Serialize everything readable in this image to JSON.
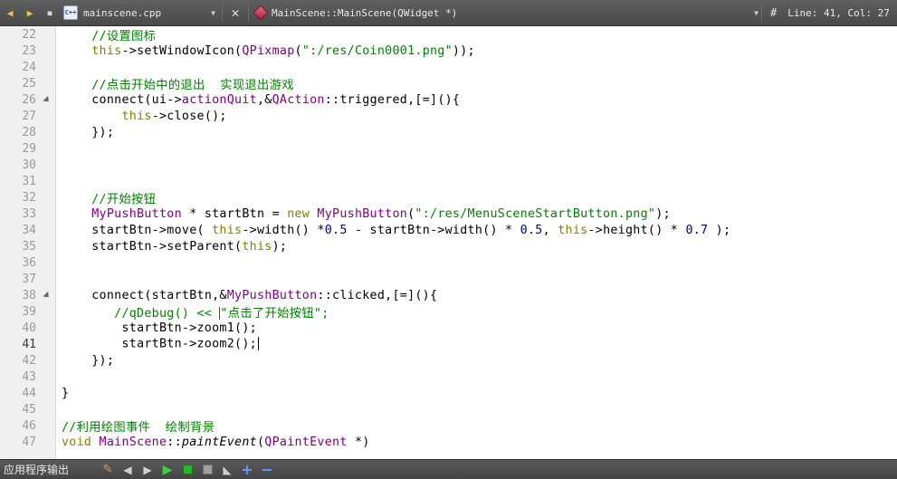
{
  "toolbar": {
    "file_name": "mainscene.cpp",
    "file_icon_text": "C++",
    "symbol": "MainScene::MainScene(QWidget *)",
    "hash": "#",
    "position": "Line: 41, Col: 27"
  },
  "editor": {
    "lines": [
      {
        "n": "22",
        "fold": false
      },
      {
        "n": "23",
        "fold": false
      },
      {
        "n": "24",
        "fold": false
      },
      {
        "n": "25",
        "fold": false
      },
      {
        "n": "26",
        "fold": true
      },
      {
        "n": "27",
        "fold": false
      },
      {
        "n": "28",
        "fold": false
      },
      {
        "n": "29",
        "fold": false
      },
      {
        "n": "30",
        "fold": false
      },
      {
        "n": "31",
        "fold": false
      },
      {
        "n": "32",
        "fold": false
      },
      {
        "n": "33",
        "fold": false
      },
      {
        "n": "34",
        "fold": false
      },
      {
        "n": "35",
        "fold": false
      },
      {
        "n": "36",
        "fold": false
      },
      {
        "n": "37",
        "fold": false
      },
      {
        "n": "38",
        "fold": true
      },
      {
        "n": "39",
        "fold": false
      },
      {
        "n": "40",
        "fold": false
      },
      {
        "n": "41",
        "fold": false
      },
      {
        "n": "42",
        "fold": false
      },
      {
        "n": "43",
        "fold": false
      },
      {
        "n": "44",
        "fold": false
      },
      {
        "n": "45",
        "fold": false
      },
      {
        "n": "46",
        "fold": false
      },
      {
        "n": "47",
        "fold": false
      }
    ],
    "code": {
      "l22_comment": "//设置图标",
      "l23_this": "this",
      "l23_a": "->setWindowIcon(",
      "l23_type": "QPixmap",
      "l23_b": "(",
      "l23_str": "\":/res/Coin0001.png\"",
      "l23_c": "));",
      "l25_comment": "//点击开始中的退出  实现退出游戏",
      "l26_a": "connect(ui->",
      "l26_mem": "actionQuit",
      "l26_b": ",&",
      "l26_type": "QAction",
      "l26_c": "::triggered,[=](){",
      "l27_this": "this",
      "l27_a": "->close();",
      "l28": "});",
      "l32_comment": "//开始按钮",
      "l33_type": "MyPushButton",
      "l33_a": " * startBtn = ",
      "l33_new": "new",
      "l33_b": " ",
      "l33_type2": "MyPushButton",
      "l33_c": "(",
      "l33_str": "\":/res/MenuSceneStartButton.png\"",
      "l33_d": ");",
      "l34_a": "startBtn->move( ",
      "l34_this1": "this",
      "l34_b": "->width() *",
      "l34_n1": "0.5",
      "l34_c": " - startBtn->width() * ",
      "l34_n2": "0.5",
      "l34_d": ", ",
      "l34_this2": "this",
      "l34_e": "->height() * ",
      "l34_n3": "0.7",
      "l34_f": " );",
      "l35_a": "startBtn->setParent(",
      "l35_this": "this",
      "l35_b": ");",
      "l38_a": "connect(startBtn,&",
      "l38_type": "MyPushButton",
      "l38_b": "::clicked,[=](){",
      "l39_comment": "//qDebug() << ",
      "l39_str": "\"点击了开始按钮\";",
      "l40": "startBtn->zoom1();",
      "l41": "startBtn->zoom2();",
      "l42": "});",
      "l44": "}",
      "l46_comment": "//利用绘图事件  绘制背景",
      "l47_void": "void",
      "l47_a": " ",
      "l47_type": "MainScene",
      "l47_b": "::",
      "l47_func": "paintEvent",
      "l47_c": "(",
      "l47_type2": "QPaintEvent",
      "l47_d": " *)"
    }
  },
  "statusbar": {
    "label": "应用程序输出"
  },
  "colors": {
    "comment": "#008000",
    "keyword": "#808000",
    "type": "#800080",
    "number": "#000080"
  }
}
